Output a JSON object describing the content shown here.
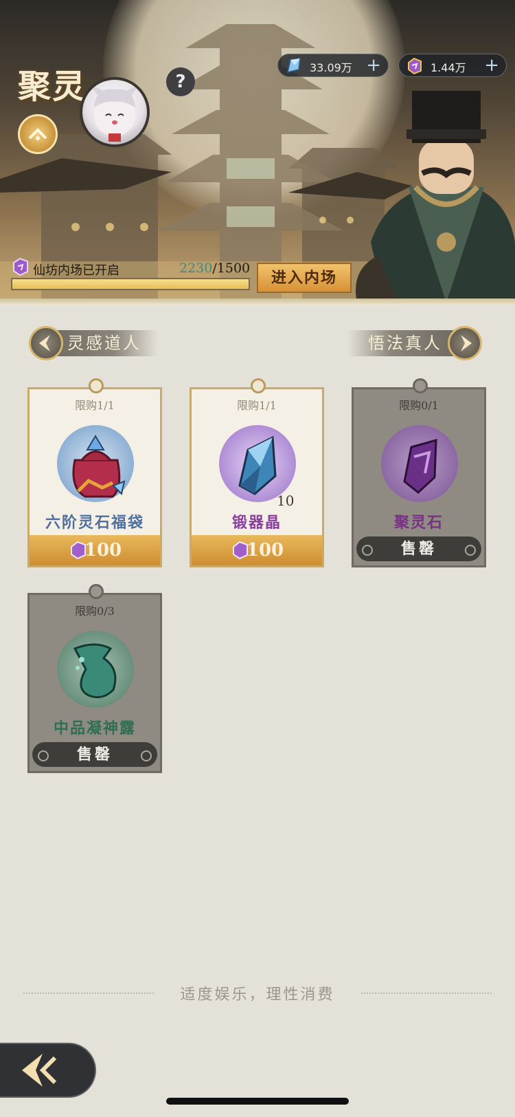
{
  "header": {
    "title": "聚灵",
    "help_label": "?",
    "currencies": [
      {
        "icon": "blue-crystal-icon",
        "value": "33.09万",
        "plus": "+"
      },
      {
        "icon": "purple-stone-icon",
        "value": "1.44万",
        "plus": "+"
      }
    ]
  },
  "progress": {
    "label": "仙坊内场已开启",
    "current": "2230",
    "separator": "/",
    "max": "1500",
    "fill_fraction": 1.0
  },
  "enter_button": "进入内场",
  "nav": {
    "left_label": "灵感道人",
    "right_label": "悟法真人"
  },
  "items": [
    {
      "limit": "限购1/1",
      "name": "六阶灵石福袋",
      "qty": "",
      "price": "100",
      "sold": false,
      "name_color": "#4f6fa0",
      "icon": "lucky-bag-icon"
    },
    {
      "limit": "限购1/1",
      "name": "锻器晶",
      "qty": "10",
      "price": "100",
      "sold": false,
      "name_color": "#8a3f9e",
      "icon": "blue-crystal-icon"
    },
    {
      "limit": "限购0/1",
      "name": "聚灵石",
      "qty": "",
      "sold_label": "售罄",
      "sold": true,
      "name_color": "#7a2f86",
      "icon": "purple-spirit-stone-icon"
    },
    {
      "limit": "限购0/3",
      "name": "中品凝神露",
      "qty": "",
      "sold_label": "售罄",
      "sold": true,
      "name_color": "#2e6e52",
      "icon": "dew-flask-icon"
    }
  ],
  "footer": {
    "slogan": "适度娱乐，理性消费"
  },
  "colors": {
    "accent_gold": "#d89235",
    "teal_value": "#3b8a86",
    "background": "#e4e2d8"
  }
}
